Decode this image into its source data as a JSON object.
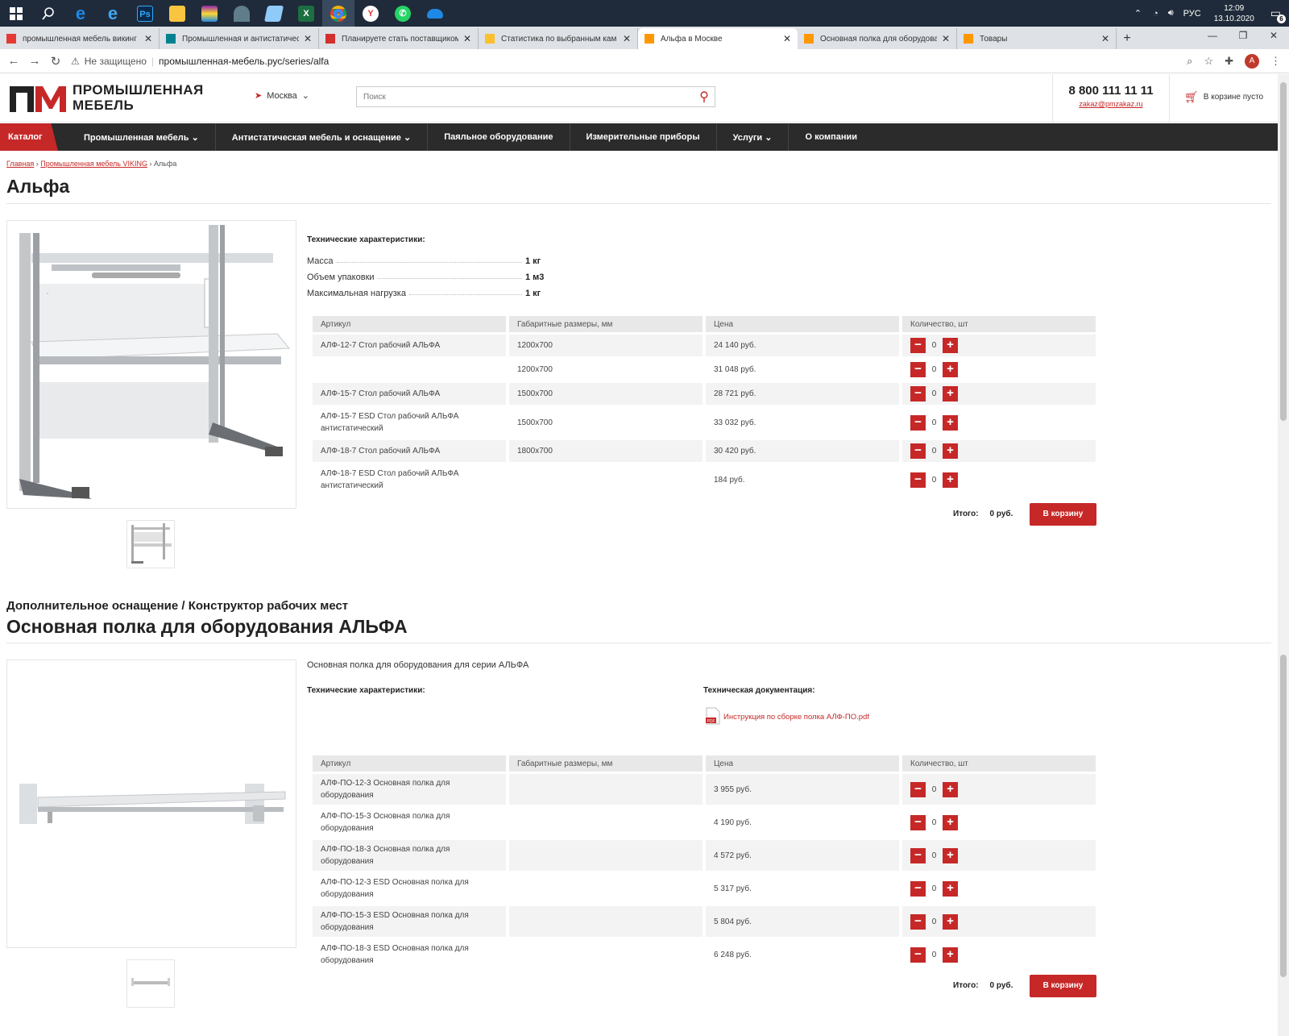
{
  "os": {
    "taskbar_icons": [
      "windows-icon",
      "search-icon",
      "edge-legacy-icon",
      "ie-icon",
      "photoshop-icon",
      "explorer-icon",
      "winrar-icon",
      "app-icon",
      "app2-icon",
      "excel-icon",
      "chrome-icon",
      "yandex-icon",
      "whatsapp-icon",
      "onedrive-icon"
    ],
    "lang": "РУС",
    "time": "12:09",
    "date": "13.10.2020",
    "notif_count": "6"
  },
  "browser": {
    "tabs": [
      {
        "title": "промышленная мебель викинг",
        "favicon_color": "#e53935",
        "active": false
      },
      {
        "title": "Промышленная и антистатическ",
        "favicon_color": "#00838f",
        "active": false
      },
      {
        "title": "Планируете стать поставщиком",
        "favicon_color": "#d32f2f",
        "active": false
      },
      {
        "title": "Статистика по выбранным кам",
        "favicon_color": "#fbc02d",
        "active": false
      },
      {
        "title": "Альфа в Москве",
        "favicon_color": "#ff9800",
        "active": true
      },
      {
        "title": "Основная полка для оборудова",
        "favicon_color": "#ff9800",
        "active": false
      },
      {
        "title": "Товары",
        "favicon_color": "#ff9800",
        "active": false
      }
    ],
    "security": "Не защищено",
    "url": "промышленная-мебель.рус/series/alfa",
    "avatar_letter": "A"
  },
  "site": {
    "logo_line1": "ПРОМЫШЛЕННАЯ",
    "logo_line2": "МЕБЕЛЬ",
    "city": "Москва",
    "search_placeholder": "Поиск",
    "phone": "8 800 111 11 11",
    "email": "zakaz@pmzakaz.ru",
    "cart": "В корзине пусто",
    "nav": {
      "catalog": "Каталог",
      "items": [
        "Промышленная мебель ⌄",
        "Антистатическая мебель и оснащение ⌄",
        "Паяльное оборудование",
        "Измерительные приборы",
        "Услуги ⌄",
        "О компании"
      ]
    },
    "breadcrumb": {
      "home": "Главная",
      "parent": "Промышленная мебель VIKING",
      "current": "Альфа"
    }
  },
  "product1": {
    "title": "Альфа",
    "spec_title": "Технические характеристики:",
    "specs": [
      {
        "k": "Масса",
        "v": "1 кг"
      },
      {
        "k": "Объем упаковки",
        "v": "1 м3"
      },
      {
        "k": "Максимальная нагрузка",
        "v": "1 кг"
      }
    ],
    "headers": [
      "Артикул",
      "Габаритные размеры, мм",
      "Цена",
      "Количество, шт"
    ],
    "rows": [
      {
        "art": "АЛФ-12-7 Стол рабочий АЛЬФА",
        "size": "1200x700",
        "price": "24 140 руб.",
        "qty": "0"
      },
      {
        "art": "",
        "size": "1200x700",
        "price": "31 048 руб.",
        "qty": "0"
      },
      {
        "art": "АЛФ-15-7 Стол рабочий АЛЬФА",
        "size": "1500x700",
        "price": "28 721 руб.",
        "qty": "0"
      },
      {
        "art": "АЛФ-15-7 ESD Стол рабочий АЛЬФА антистатический",
        "size": "1500x700",
        "price": "33 032 руб.",
        "qty": "0"
      },
      {
        "art": "АЛФ-18-7 Стол рабочий АЛЬФА",
        "size": "1800x700",
        "price": "30 420 руб.",
        "qty": "0"
      },
      {
        "art": "АЛФ-18-7 ESD Стол рабочий АЛЬФА антистатический",
        "size": "",
        "price": "184 руб.",
        "qty": "0"
      }
    ],
    "total_label": "Итого:",
    "total_value": "0 руб.",
    "button": "В корзину"
  },
  "product2": {
    "category": "Дополнительное оснащение / Конструктор рабочих мест",
    "title": "Основная полка для оборудования АЛЬФА",
    "description": "Основная полка для оборудования для серии АЛЬФА",
    "spec_title": "Технические характеристики:",
    "doc_title": "Техническая документация:",
    "doc_link": "Инструкция по сборке полка АЛФ-ПО.pdf",
    "headers": [
      "Артикул",
      "Габаритные размеры, мм",
      "Цена",
      "Количество, шт"
    ],
    "rows": [
      {
        "art": "АЛФ-ПО-12-3 Основная полка для оборудования",
        "size": "",
        "price": "3 955 руб.",
        "qty": "0"
      },
      {
        "art": "АЛФ-ПО-15-3 Основная полка для оборудования",
        "size": "",
        "price": "4 190 руб.",
        "qty": "0"
      },
      {
        "art": "АЛФ-ПО-18-3 Основная полка для оборудования",
        "size": "",
        "price": "4 572 руб.",
        "qty": "0"
      },
      {
        "art": "АЛФ-ПО-12-3 ESD Основная полка для оборудования",
        "size": "",
        "price": "5 317 руб.",
        "qty": "0"
      },
      {
        "art": "АЛФ-ПО-15-3 ESD Основная полка для оборудования",
        "size": "",
        "price": "5 804 руб.",
        "qty": "0"
      },
      {
        "art": "АЛФ-ПО-18-3 ESD Основная полка для оборудования",
        "size": "",
        "price": "6 248 руб.",
        "qty": "0"
      }
    ],
    "total_label": "Итого:",
    "total_value": "0 руб.",
    "button": "В корзину"
  },
  "colors": {
    "accent": "#c62828",
    "nav_bg": "#2b2b2b",
    "taskbar": "#1f2b3a"
  }
}
